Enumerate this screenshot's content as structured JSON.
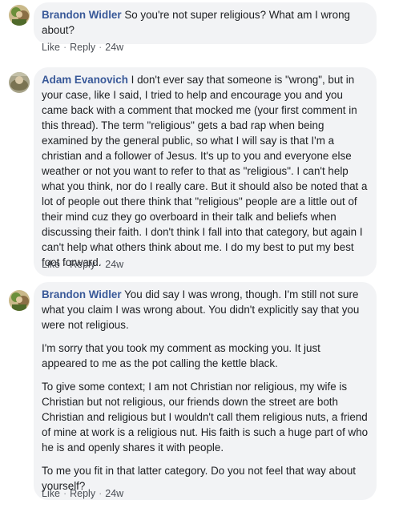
{
  "comments": [
    {
      "author": "Brandon Widler",
      "paragraphs": [
        "So you're not super religious? What am I wrong about?"
      ],
      "actions": {
        "like": "Like",
        "reply": "Reply",
        "time": "24w"
      }
    },
    {
      "author": "Adam Evanovich",
      "paragraphs": [
        "I don't ever say that someone is \"wrong\", but in your case, like I said, I tried to help and encourage you and you came back with a comment that mocked me (your first comment in this thread). The term \"religious\" gets a bad rap when being examined by the general public, so what I will say is that I'm a christian and a follower of Jesus. It's up to you and everyone else weather or not you want to refer to that as \"religious\". I can't help what you think, nor do I really care. But it should also be noted that a lot of people out there think that \"religious\" people are a little out of their mind cuz they go overboard in their talk and beliefs when discussing their faith. I don't think I fall into that category, but again I can't help what others think about me. I do my best to put my best foot forward."
      ],
      "actions": {
        "like": "Like",
        "reply": "Reply",
        "time": "24w"
      }
    },
    {
      "author": "Brandon Widler",
      "paragraphs": [
        "You did say I was wrong, though. I'm still not sure what you claim I was wrong about. You didn't explicitly say that you were not religious.",
        "I'm sorry that you took my comment as mocking you. It just appeared to me as the pot calling the kettle black.",
        "To give some context; I am not Christian nor religious, my wife is Christian but not religious, our friends down the street are both Christian and religious but I wouldn't call them religious nuts, a friend of mine at work is a religious nut. His faith is such a huge part of who he is and openly shares it with people.",
        "To me you fit in that latter category. Do you not feel that way about yourself?"
      ],
      "actions": {
        "like": "Like",
        "reply": "Reply",
        "time": "24w"
      }
    }
  ]
}
